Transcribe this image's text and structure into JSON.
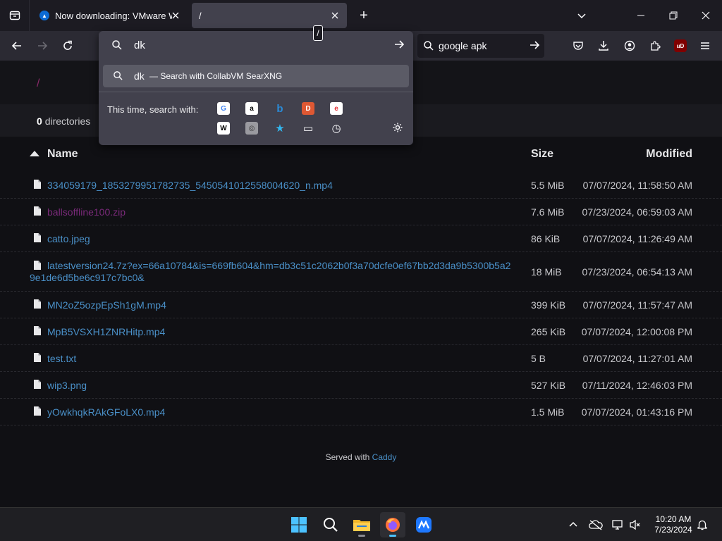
{
  "browser": {
    "tabs": [
      {
        "title": "Now downloading: VMware Wo"
      },
      {
        "title": "/"
      }
    ],
    "new_tab": "+",
    "search_bar": {
      "text": "google apk"
    }
  },
  "url_panel": {
    "query": "dk",
    "shortcut_hint": "/",
    "suggestion": {
      "query": "dk",
      "action": "— Search with CollabVM SearXNG"
    },
    "one_time_label": "This time, search with:",
    "engines": [
      {
        "name": "google-engine",
        "glyph": "G",
        "color": "#4285f4",
        "bg": "#ffffff"
      },
      {
        "name": "amazon-engine",
        "glyph": "a",
        "color": "#000000",
        "bg": "#ffffff"
      },
      {
        "name": "bing-engine",
        "glyph": "b",
        "color": "#2a8bd8",
        "bg": "transparent"
      },
      {
        "name": "duckduckgo-engine",
        "glyph": "D",
        "color": "#ffffff",
        "bg": "#de5833"
      },
      {
        "name": "ebay-engine",
        "glyph": "e",
        "color": "#e53238",
        "bg": "#ffffff"
      },
      {
        "name": "wikipedia-engine",
        "glyph": "W",
        "color": "#000000",
        "bg": "#ffffff"
      },
      {
        "name": "searxng-engine",
        "glyph": "◎",
        "color": "#333333",
        "bg": "#9a9aa0"
      },
      {
        "name": "bookmarks-star-icon",
        "glyph": "★",
        "color": "#33b8f0",
        "bg": "transparent"
      },
      {
        "name": "tabs-icon",
        "glyph": "▭",
        "color": "#fbfbfe",
        "bg": "transparent"
      },
      {
        "name": "history-icon",
        "glyph": "◷",
        "color": "#fbfbfe",
        "bg": "transparent"
      }
    ]
  },
  "listing": {
    "path": "/",
    "dir_count": "0",
    "dir_label": "directories",
    "columns": {
      "name": "Name",
      "size": "Size",
      "modified": "Modified"
    },
    "files": [
      {
        "name": "334059179_1853279951782735_5450541012558004620_n.mp4",
        "size": "5.5 MiB",
        "modified": "07/07/2024, 11:58:50 AM"
      },
      {
        "name": "ballsoffline100.zip",
        "size": "7.6 MiB",
        "modified": "07/23/2024, 06:59:03 AM"
      },
      {
        "name": "catto.jpeg",
        "size": "86 KiB",
        "modified": "07/07/2024, 11:26:49 AM"
      },
      {
        "name": "latestversion24.7z?ex=66a10784&is=669fb604&hm=db3c51c2062b0f3a70dcfe0ef67bb2d3da9b5300b5a29e1de6d5be6c917c7bc0&",
        "size": "18 MiB",
        "modified": "07/23/2024, 06:54:13 AM"
      },
      {
        "name": "MN2oZ5ozpEpSh1gM.mp4",
        "size": "399 KiB",
        "modified": "07/07/2024, 11:57:47 AM"
      },
      {
        "name": "MpB5VSXH1ZNRHitp.mp4",
        "size": "265 KiB",
        "modified": "07/07/2024, 12:00:08 PM"
      },
      {
        "name": "test.txt",
        "size": "5 B",
        "modified": "07/07/2024, 11:27:01 AM"
      },
      {
        "name": "wip3.png",
        "size": "527 KiB",
        "modified": "07/11/2024, 12:46:03 PM"
      },
      {
        "name": "yOwkhqkRAkGFoLX0.mp4",
        "size": "1.5 MiB",
        "modified": "07/07/2024, 01:43:16 PM"
      }
    ],
    "footer_prefix": "Served with",
    "footer_link": "Caddy"
  },
  "taskbar": {
    "time": "10:20 AM",
    "date": "7/23/2024"
  }
}
